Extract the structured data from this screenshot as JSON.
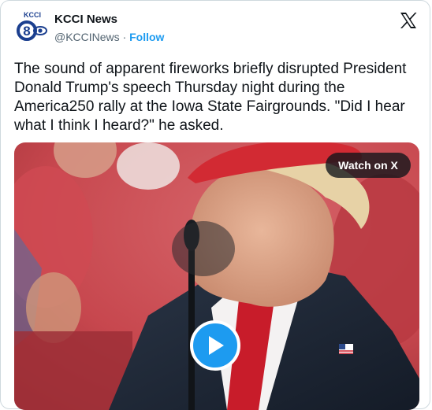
{
  "account": {
    "name": "KCCI News",
    "handle": "@KCCINews",
    "separator": "·",
    "follow_label": "Follow",
    "logo_text": "KCCI"
  },
  "header": {
    "x_logo": "x-logo-icon"
  },
  "tweet": {
    "text": "The sound of apparent fireworks briefly disrupted President Donald Trump's speech Thursday night during the America250 rally at the Iowa State Fairgrounds. \"Did I hear what I think I heard?\" he asked."
  },
  "media": {
    "watch_label": "Watch on X",
    "play_icon": "play-icon"
  },
  "colors": {
    "brand_blue": "#1d9bf0",
    "text_primary": "#0f1419",
    "text_secondary": "#536471",
    "border": "#cfd9de",
    "hat_red": "#d22a33",
    "suit": "#1f2a3a"
  }
}
